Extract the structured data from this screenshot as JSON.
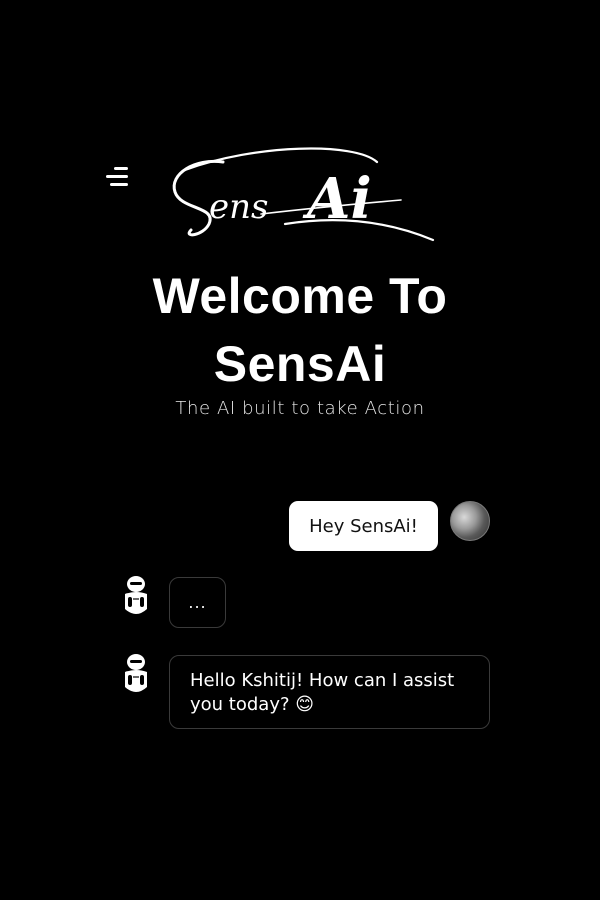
{
  "header": {
    "menu_icon": "menu-icon",
    "logo_text": "SensAi"
  },
  "hero": {
    "title_line1": "Welcome To",
    "title_line2": "SensAi",
    "subtitle": "The AI built to take Action"
  },
  "chat": {
    "messages": [
      {
        "role": "user",
        "text": "Hey SensAi!",
        "avatar": "user-avatar"
      },
      {
        "role": "bot",
        "text": "...",
        "avatar": "robot-icon"
      },
      {
        "role": "bot",
        "text": "Hello Kshitij! How can I assist you today? 😊",
        "avatar": "robot-icon"
      }
    ]
  },
  "colors": {
    "background": "#000000",
    "text": "#ffffff",
    "user_bubble": "#ffffff",
    "bot_bubble_border": "#3a3a3a"
  }
}
